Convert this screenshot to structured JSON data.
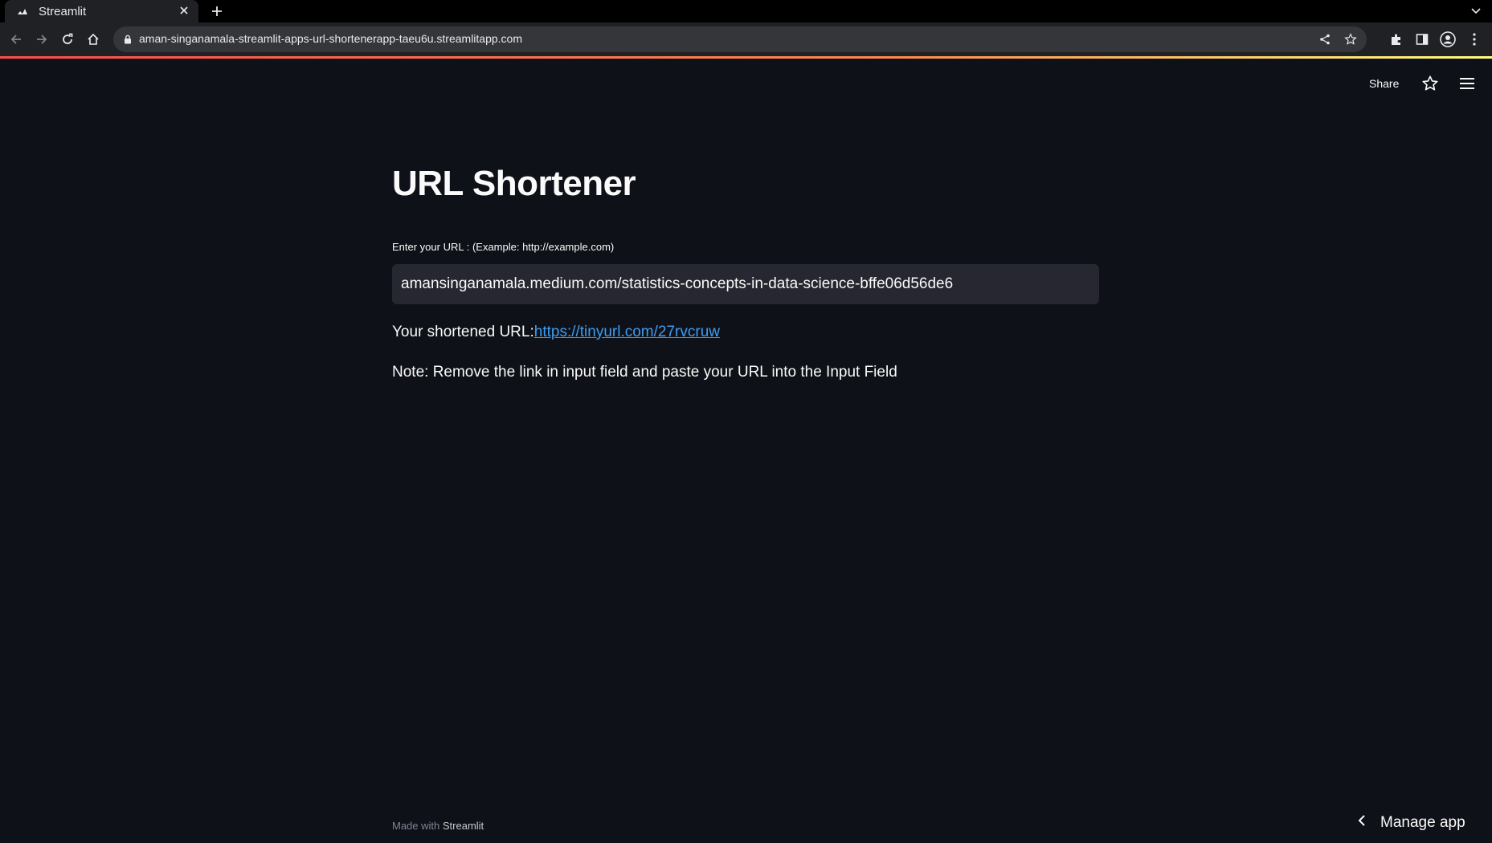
{
  "browser": {
    "tab_title": "Streamlit",
    "url": "aman-singanamala-streamlit-apps-url-shortenerapp-taeu6u.streamlitapp.com"
  },
  "header": {
    "share_label": "Share"
  },
  "main": {
    "title": "URL Shortener",
    "input_label": "Enter your URL : (Example: http://example.com)",
    "input_value": "amansinganamala.medium.com/statistics-concepts-in-data-science-bffe06d56de6",
    "result_prefix": "Your shortened URL:",
    "result_link": "https://tinyurl.com/27rvcruw",
    "note": "Note: Remove the link in input field and paste your URL into the Input Field"
  },
  "footer": {
    "made_with": "Made with",
    "brand": "Streamlit"
  },
  "manage_app": {
    "label": "Manage app"
  },
  "colors": {
    "background": "#0e1117",
    "input_background": "#262730",
    "link": "#3d9df3",
    "accent_start": "#ff4b4b",
    "accent_end": "#fffd80"
  }
}
